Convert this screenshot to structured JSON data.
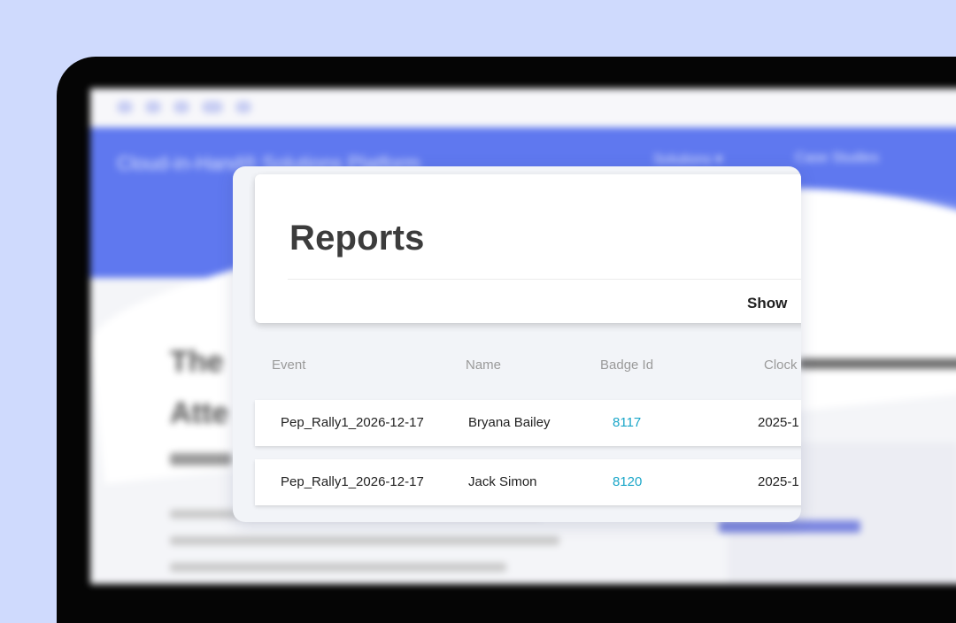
{
  "colors": {
    "background": "#cfdafd",
    "hero": "#5f78ef",
    "badge_link": "#1aa6c8"
  },
  "background_page": {
    "brand": "Cloud-in-Hand® Solutions Platform",
    "nav": [
      "Solutions ▾",
      "Case Studies"
    ],
    "heading_lines": [
      "The",
      "Atte"
    ]
  },
  "report": {
    "title": "Reports",
    "show_label": "Show",
    "columns": [
      "Event",
      "Name",
      "Badge Id",
      "Clock"
    ],
    "rows": [
      {
        "event": "Pep_Rally1_2026-12-17",
        "name": "Bryana Bailey",
        "badge_id": "8117",
        "clock": "2025-1"
      },
      {
        "event": "Pep_Rally1_2026-12-17",
        "name": "Jack Simon",
        "badge_id": "8120",
        "clock": "2025-1"
      }
    ]
  }
}
